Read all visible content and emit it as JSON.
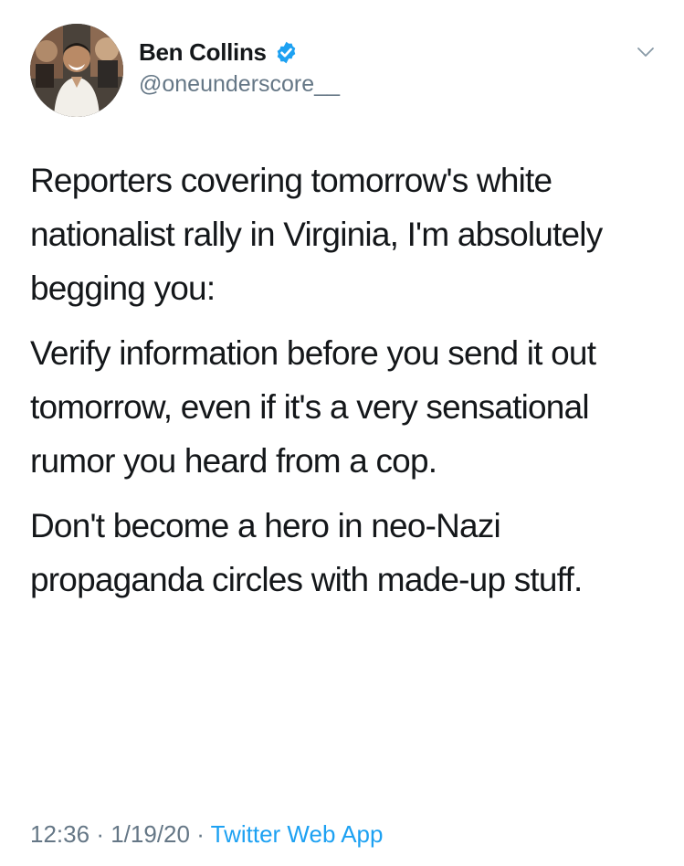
{
  "author": {
    "display_name": "Ben Collins",
    "handle": "@oneunderscore__",
    "verified_icon": "verified-badge-icon"
  },
  "menu": {
    "icon": "chevron-down-icon"
  },
  "tweet": {
    "paragraphs": [
      "Reporters covering tomorrow's white nationalist rally in Virginia, I'm absolutely begging you:",
      "Verify information before you send it out tomorrow, even if it's a very sensational rumor you heard from a cop.",
      "Don't become a hero in neo-Nazi propaganda circles with made-up stuff."
    ]
  },
  "meta": {
    "time": "12:36",
    "separator": "·",
    "date": "1/19/20",
    "source": "Twitter Web App"
  },
  "colors": {
    "text": "#14171a",
    "secondary": "#657786",
    "accent": "#1da1f2"
  }
}
